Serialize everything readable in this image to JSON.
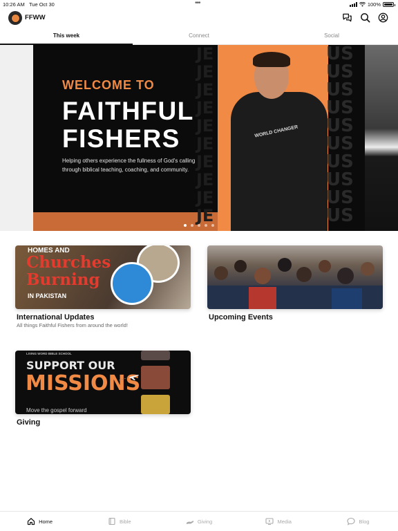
{
  "status": {
    "time": "10:26 AM",
    "date": "Tue Oct 30",
    "battery": "100%"
  },
  "header": {
    "title": "FFWW",
    "icons": [
      "chat-icon",
      "search-icon",
      "account-icon"
    ]
  },
  "tabs": [
    {
      "label": "This week",
      "active": true
    },
    {
      "label": "Connect",
      "active": false
    },
    {
      "label": "Social",
      "active": false
    }
  ],
  "carousel": {
    "welcome": "WELCOME TO",
    "headline_line1": "FAITHFUL",
    "headline_line2": "FISHERS",
    "blurb": "Helping others experience the fullness of God's calling through biblical teaching, coaching, and community.",
    "shirt_text": "WORLD CHANGER",
    "pages": 5,
    "current_page": 1
  },
  "cards": {
    "international": {
      "image_text": {
        "line1": "HOMES AND",
        "line2": "Churches",
        "line3": "Burning",
        "line4": "IN PAKISTAN"
      },
      "title": "International Updates",
      "subtitle": "All things Faithful Fishers from around the world!"
    },
    "events": {
      "title": "Upcoming Events"
    },
    "giving": {
      "image_text": {
        "school": "LIVING WORD BIBLE SCHOOL",
        "line1": "SUPPORT OUR",
        "line2": "MISSIONS",
        "line3": "Move the gospel forward"
      },
      "title": "Giving"
    }
  },
  "bottom_nav": [
    {
      "label": "Home",
      "icon": "home-icon",
      "active": true
    },
    {
      "label": "Bible",
      "icon": "book-icon",
      "active": false
    },
    {
      "label": "Giving",
      "icon": "giving-icon",
      "active": false
    },
    {
      "label": "Media",
      "icon": "media-icon",
      "active": false
    },
    {
      "label": "Blog",
      "icon": "blog-icon",
      "active": false
    }
  ]
}
